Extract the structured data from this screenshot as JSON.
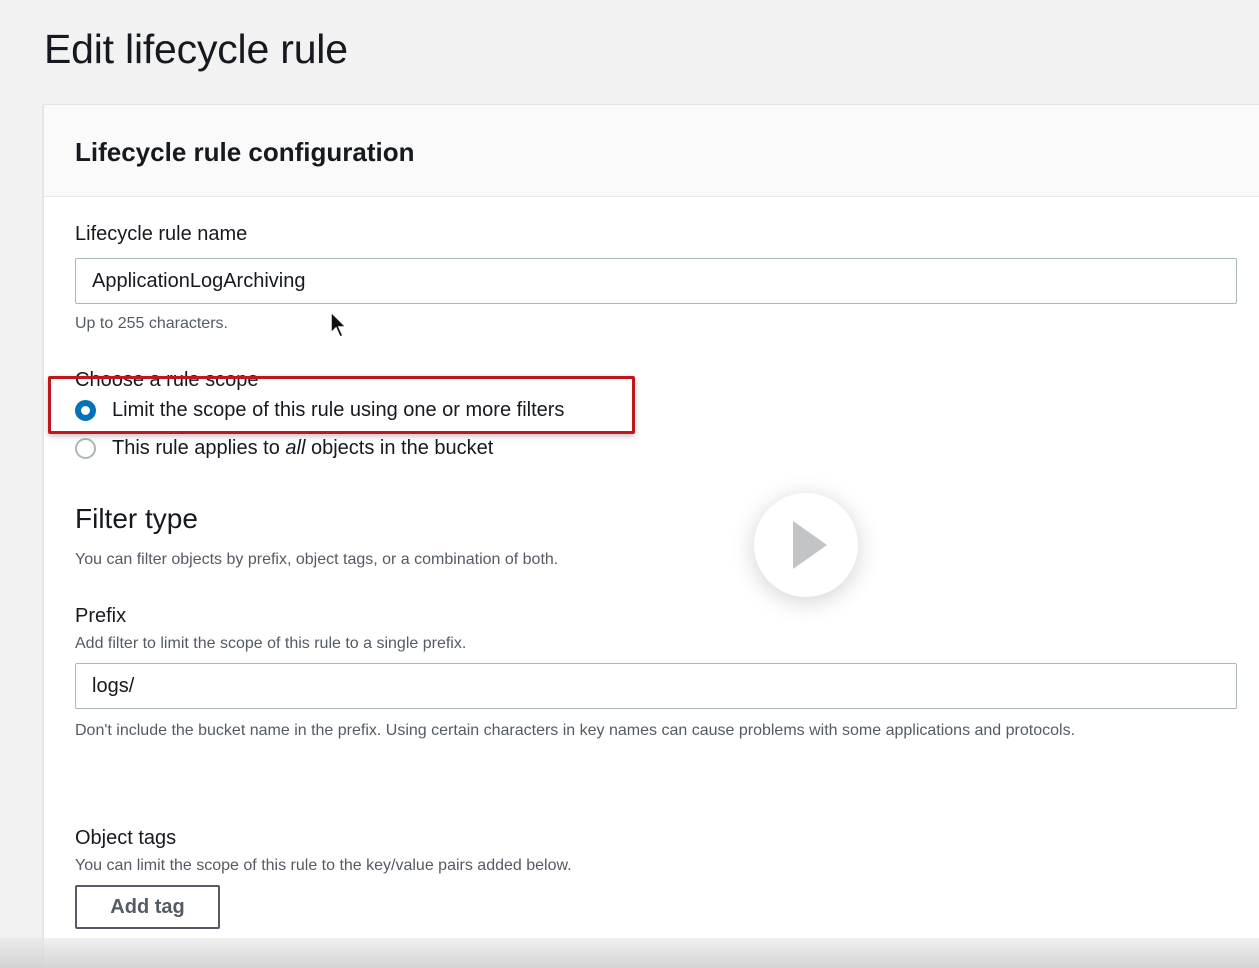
{
  "page": {
    "title": "Edit lifecycle rule"
  },
  "panel": {
    "title": "Lifecycle rule configuration"
  },
  "rule_name": {
    "label": "Lifecycle rule name",
    "value": "ApplicationLogArchiving",
    "hint": "Up to 255 characters."
  },
  "scope": {
    "label": "Choose a rule scope",
    "options": [
      {
        "label": "Limit the scope of this rule using one or more filters",
        "selected": true
      },
      {
        "label_before": "This rule applies to ",
        "label_em": "all",
        "label_after": " objects in the bucket",
        "selected": false
      }
    ]
  },
  "filter_type": {
    "title": "Filter type",
    "description": "You can filter objects by prefix, object tags, or a combination of both."
  },
  "prefix": {
    "label": "Prefix",
    "description": "Add filter to limit the scope of this rule to a single prefix.",
    "value": "logs/",
    "hint": "Don't include the bucket name in the prefix. Using certain characters in key names can cause problems with some applications and protocols."
  },
  "object_tags": {
    "label": "Object tags",
    "description": "You can limit the scope of this rule to the key/value pairs added below.",
    "add_button": "Add tag"
  },
  "colors": {
    "accent": "#0073bb",
    "highlight": "#c0171e",
    "text": "#16191f",
    "secondary_text": "#545b64"
  },
  "icons": {
    "play": "play-icon",
    "cursor": "mouse-cursor-icon"
  }
}
